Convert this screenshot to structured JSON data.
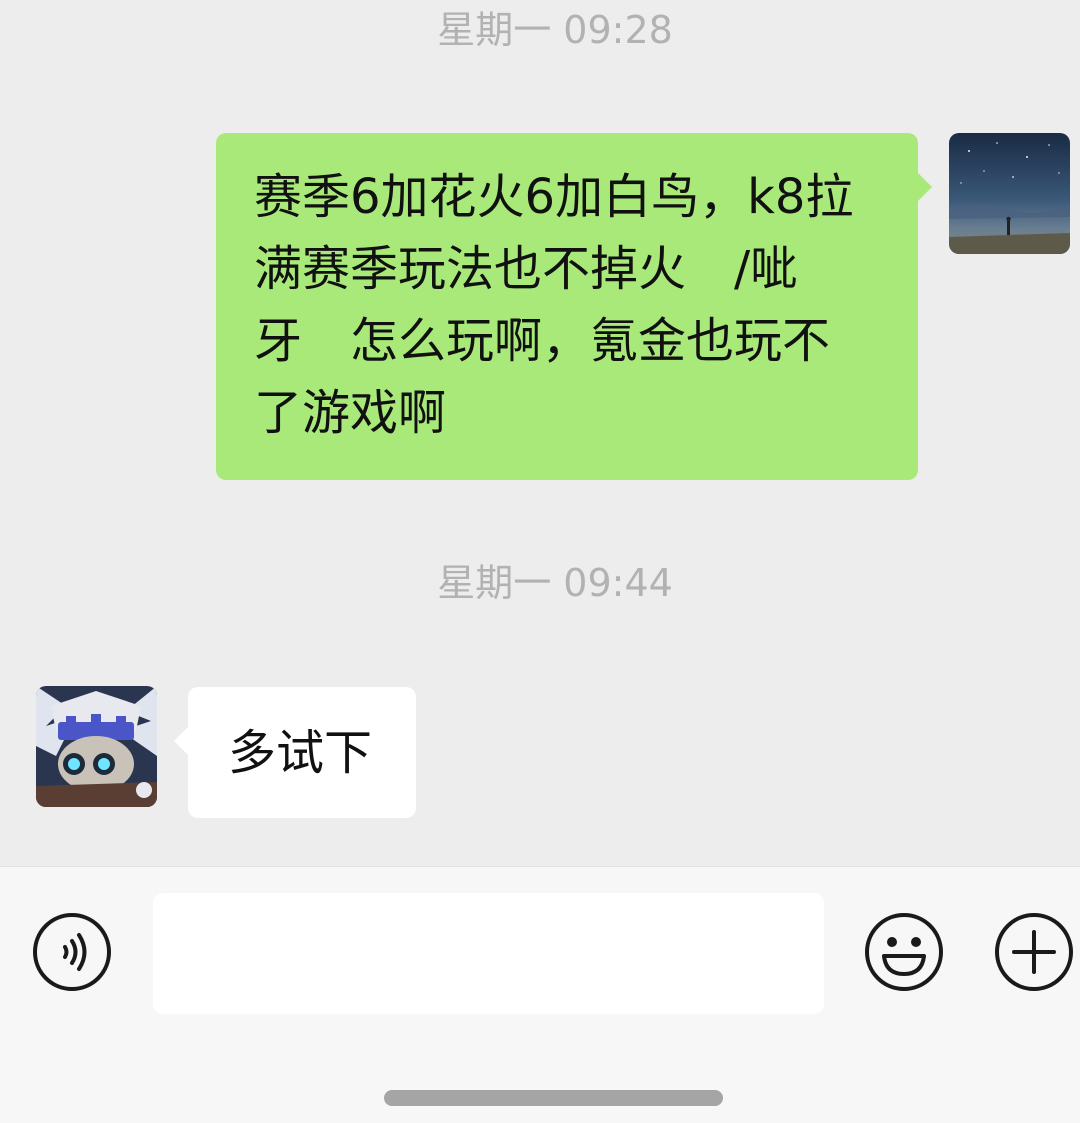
{
  "messages": [
    {
      "timestamp": "星期一 09:28",
      "sender": "self",
      "text": "赛季6加花火6加白鸟，k8拉\n满赛季玩法也不掉火　/呲\n牙　怎么玩啊，氪金也玩不\n了游戏啊"
    },
    {
      "timestamp": "星期一 09:44",
      "sender": "peer",
      "text": "多试下"
    }
  ],
  "colors": {
    "chat_background": "#ededed",
    "self_bubble": "#a9e97a",
    "peer_bubble": "#ffffff",
    "input_bar": "#f7f7f7",
    "timestamp_text": "#b2b2b2"
  },
  "input_bar": {
    "text_value": "",
    "left_icon": "voice-icon",
    "right_icons": [
      "emoji-icon",
      "plus-icon"
    ]
  }
}
